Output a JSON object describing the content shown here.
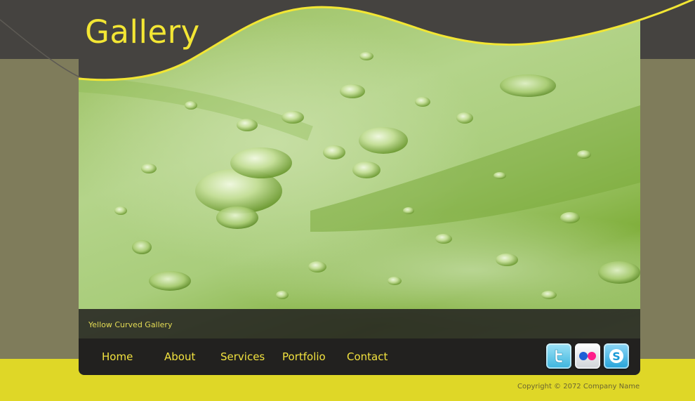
{
  "site": {
    "logo_text": "Gallery",
    "caption": "Yellow Curved Gallery",
    "copyright": "Copyright © 2072 Company Name"
  },
  "nav": {
    "items": [
      {
        "label": "Home"
      },
      {
        "label": "About"
      },
      {
        "label": "Services"
      },
      {
        "label": "Portfolio"
      },
      {
        "label": "Contact"
      }
    ]
  },
  "social": [
    {
      "icon": "twitter-icon"
    },
    {
      "icon": "flickr-icon"
    },
    {
      "icon": "skype-icon"
    }
  ],
  "colors": {
    "header_dark": "#454340",
    "side_olive": "#7f7c5b",
    "footer_yellow": "#dfd727",
    "accent_yellow": "#f2e23f",
    "bar_dark": "#22211f"
  },
  "hero_image": {
    "subject": "green leaf with water droplets"
  }
}
